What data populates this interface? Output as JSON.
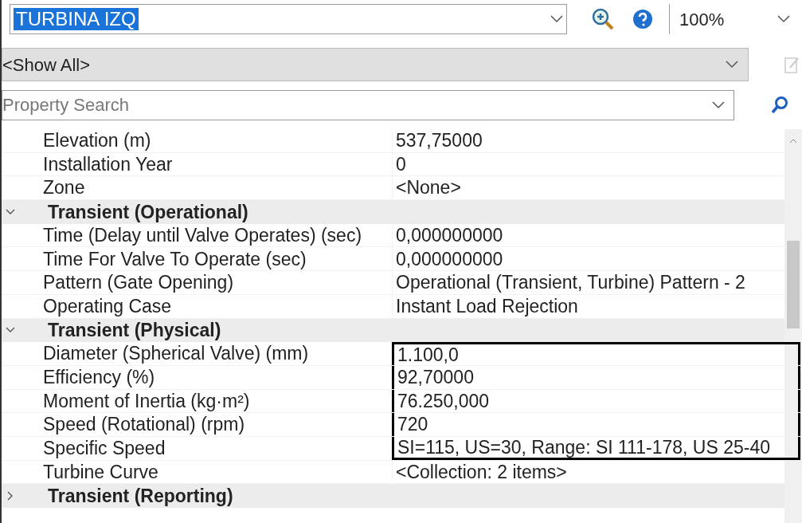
{
  "element_selector": {
    "value": "TURBINA IZQ",
    "selected": true
  },
  "zoom": {
    "value": "100%"
  },
  "filter": {
    "value": "<Show All>"
  },
  "search": {
    "placeholder": "Property Search"
  },
  "rows": [
    {
      "kind": "property",
      "name": "Elevation (m)",
      "value": "537,75000",
      "framed": false
    },
    {
      "kind": "property",
      "name": "Installation Year",
      "value": "0",
      "framed": false
    },
    {
      "kind": "property",
      "name": "Zone",
      "value": "<None>",
      "framed": false
    },
    {
      "kind": "category",
      "name": "Transient (Operational)",
      "expanded": true
    },
    {
      "kind": "property",
      "name": "Time (Delay until Valve Operates) (sec)",
      "value": "0,000000000",
      "framed": false
    },
    {
      "kind": "property",
      "name": "Time For Valve To Operate (sec)",
      "value": "0,000000000",
      "framed": false
    },
    {
      "kind": "property",
      "name": "Pattern (Gate Opening)",
      "value": "Operational (Transient, Turbine) Pattern - 2",
      "framed": false
    },
    {
      "kind": "property",
      "name": "Operating Case",
      "value": "Instant Load Rejection",
      "framed": false
    },
    {
      "kind": "category",
      "name": "Transient (Physical)",
      "expanded": true
    },
    {
      "kind": "property",
      "name": "Diameter (Spherical Valve) (mm)",
      "value": "1.100,0",
      "framed": true
    },
    {
      "kind": "property",
      "name": "Efficiency (%)",
      "value": "92,70000",
      "framed": true
    },
    {
      "kind": "property",
      "name": "Moment of Inertia (kg·m²)",
      "value": "76.250,000",
      "framed": true
    },
    {
      "kind": "property",
      "name": "Speed (Rotational) (rpm)",
      "value": "720",
      "framed": true
    },
    {
      "kind": "property",
      "name": "Specific Speed",
      "value": "SI=115, US=30, Range: SI 111-178, US 25-40",
      "framed": true
    },
    {
      "kind": "property",
      "name": "Turbine Curve",
      "value": "<Collection: 2 items>",
      "framed": false
    },
    {
      "kind": "category",
      "name": "Transient (Reporting)",
      "expanded": false
    }
  ]
}
